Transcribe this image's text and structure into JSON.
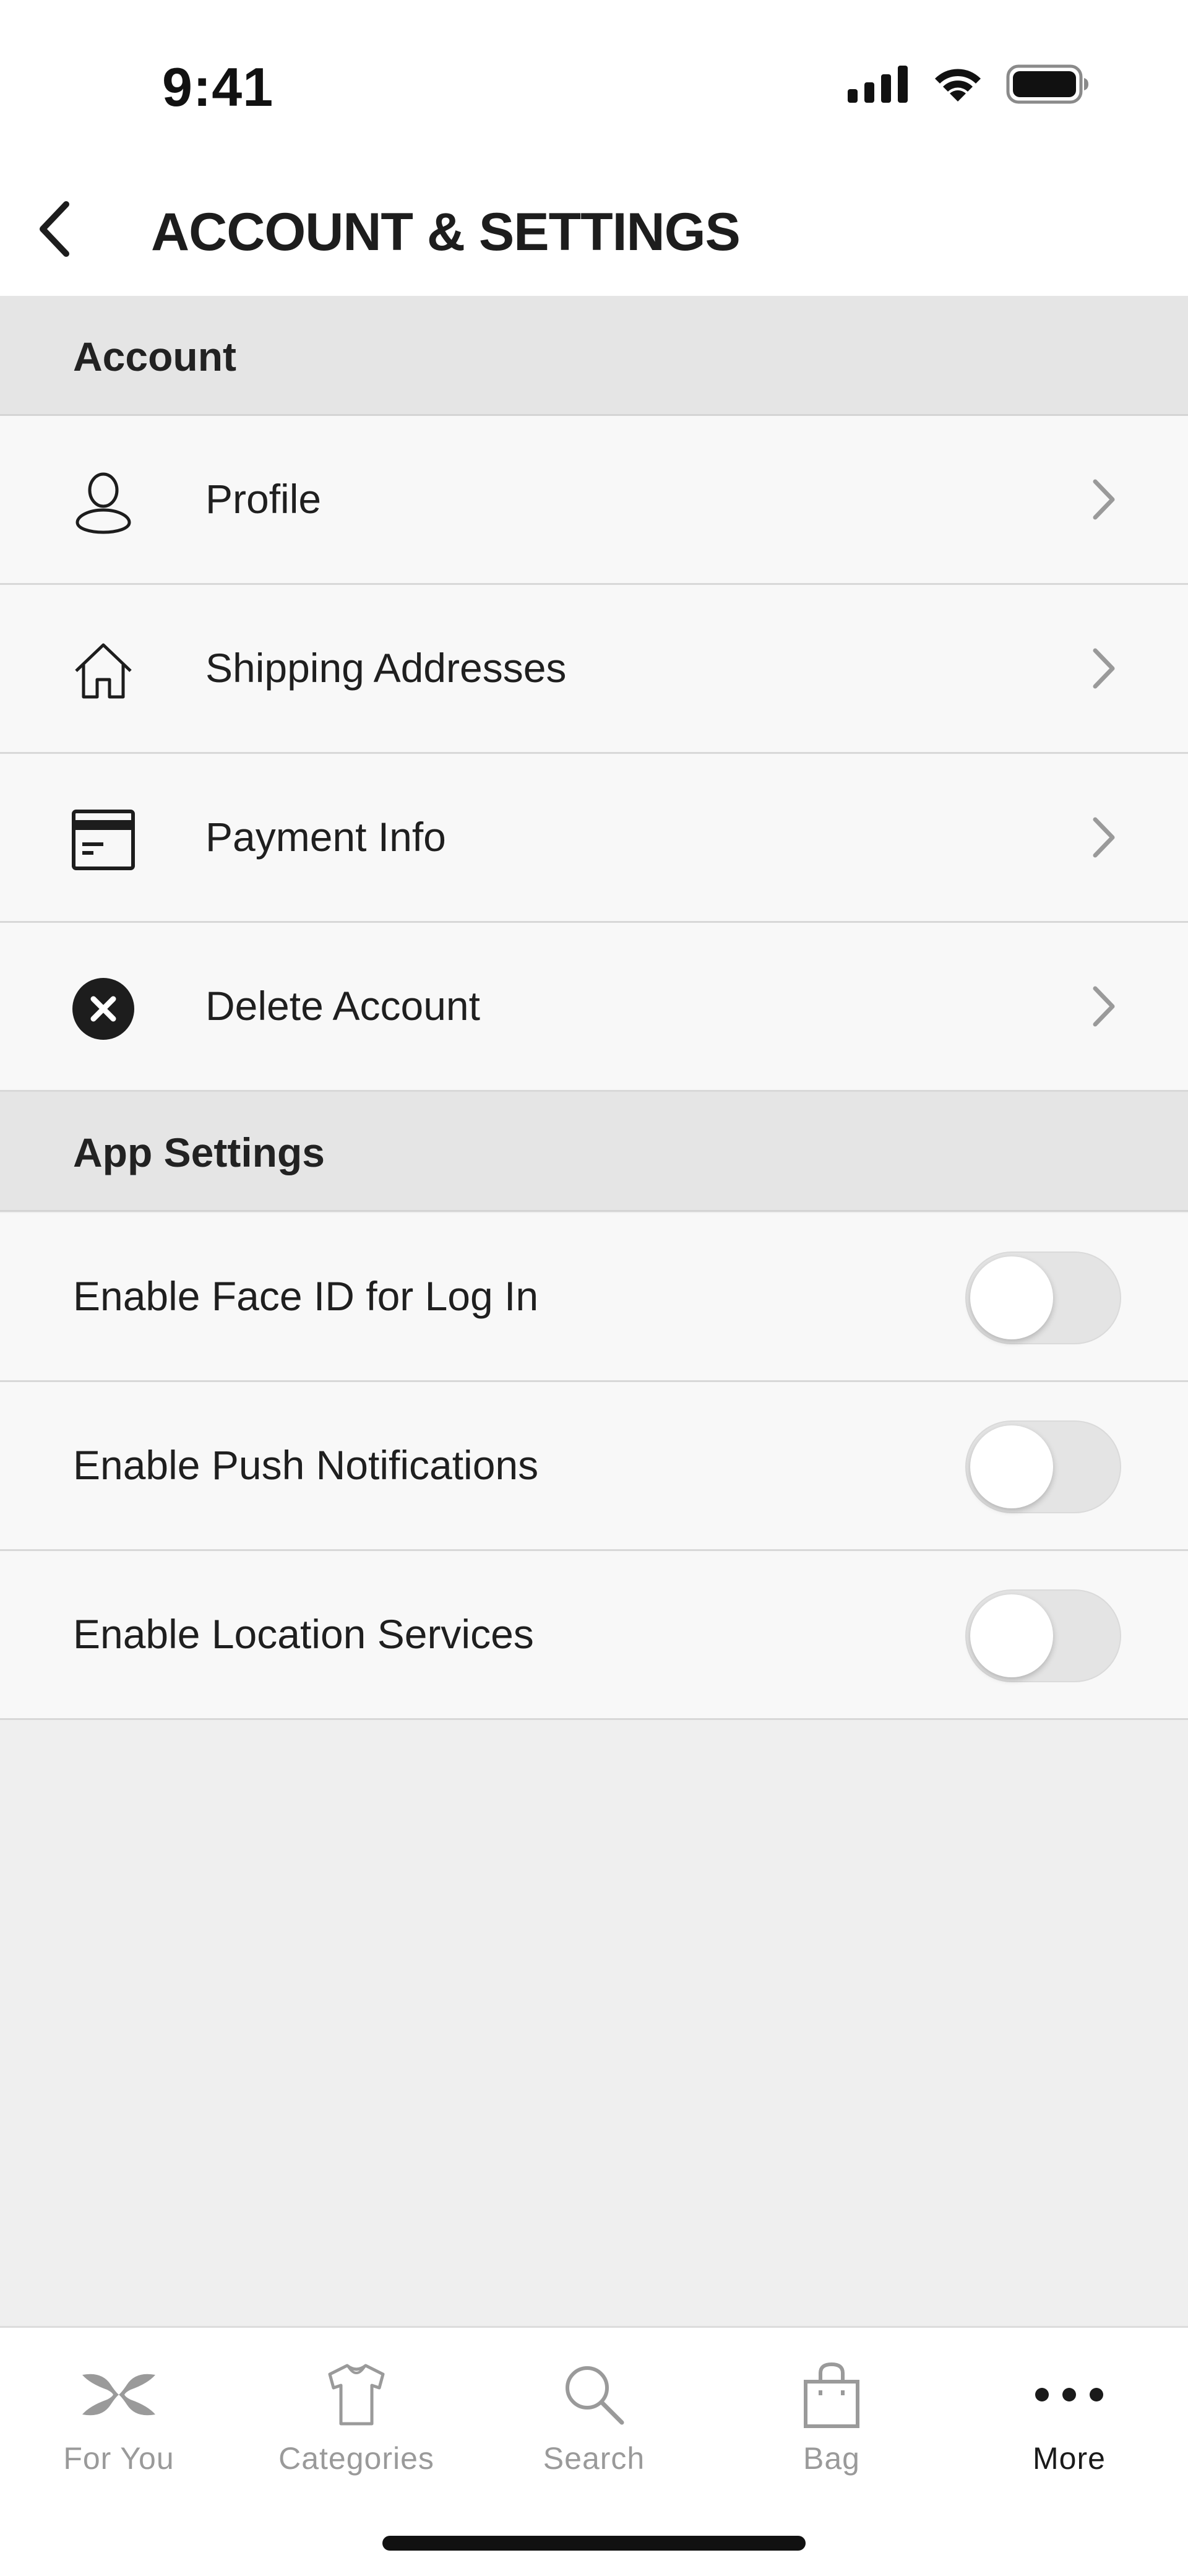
{
  "status_bar": {
    "time": "9:41"
  },
  "header": {
    "title": "ACCOUNT & SETTINGS",
    "back_icon": "chevron-left-icon"
  },
  "sections": {
    "account": {
      "title": "Account",
      "items": [
        {
          "label": "Profile",
          "icon": "user-icon"
        },
        {
          "label": "Shipping Addresses",
          "icon": "home-icon"
        },
        {
          "label": "Payment Info",
          "icon": "credit-card-icon"
        },
        {
          "label": "Delete Account",
          "icon": "close-circle-icon"
        }
      ]
    },
    "app_settings": {
      "title": "App Settings",
      "items": [
        {
          "label": "Enable Face ID for Log In",
          "enabled": false
        },
        {
          "label": "Enable Push Notifications",
          "enabled": false
        },
        {
          "label": "Enable Location Services",
          "enabled": false
        }
      ]
    }
  },
  "tab_bar": {
    "tabs": [
      {
        "label": "For You",
        "icon": "brand-logo-icon",
        "active": false
      },
      {
        "label": "Categories",
        "icon": "shirt-icon",
        "active": false
      },
      {
        "label": "Search",
        "icon": "search-icon",
        "active": false
      },
      {
        "label": "Bag",
        "icon": "bag-icon",
        "active": false
      },
      {
        "label": "More",
        "icon": "more-dots-icon",
        "active": true
      }
    ]
  },
  "colors": {
    "background": "#efefef",
    "section_header": "#e5e5e5",
    "row_background": "#f8f8f8",
    "text": "#1d1d1d",
    "inactive_tab": "#9a9a9a"
  }
}
